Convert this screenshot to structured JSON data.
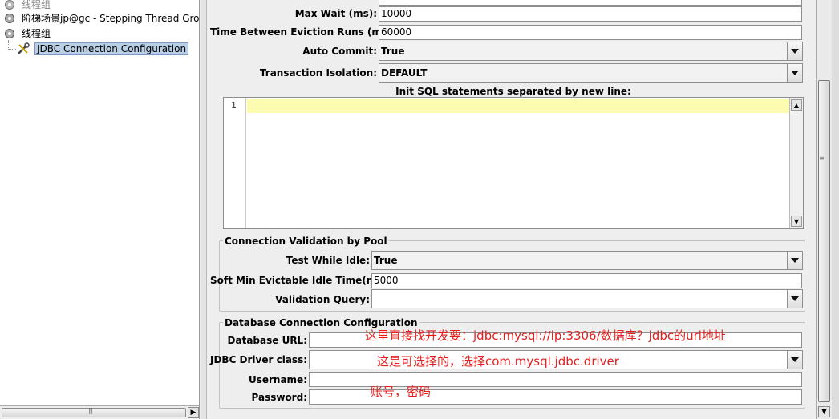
{
  "tree": {
    "items": [
      {
        "label": "线程组",
        "icon": "gear-icon"
      },
      {
        "label": "阶梯场景jp@gc - Stepping Thread Group",
        "icon": "gear-icon"
      },
      {
        "label": "线程组",
        "icon": "gear-icon"
      },
      {
        "label": "JDBC Connection Configuration",
        "icon": "wrench-icon",
        "selected": true
      }
    ]
  },
  "pool": {
    "max_wait_label": "Max Wait (ms):",
    "max_wait_value": "10000",
    "eviction_label": "Time Between Eviction Runs (ms):",
    "eviction_value": "60000",
    "auto_commit_label": "Auto Commit:",
    "auto_commit_value": "True",
    "isolation_label": "Transaction Isolation:",
    "isolation_value": "DEFAULT",
    "init_sql_label": "Init SQL statements separated by new line:",
    "init_sql_line_number": "1"
  },
  "validation": {
    "title": "Connection Validation by Pool",
    "test_idle_label": "Test While Idle:",
    "test_idle_value": "True",
    "soft_min_label": "Soft Min Evictable Idle Time(ms):",
    "soft_min_value": "5000",
    "query_label": "Validation Query:",
    "query_value": ""
  },
  "database": {
    "title": "Database Connection Configuration",
    "url_label": "Database URL:",
    "url_value": "",
    "driver_label": "JDBC Driver class:",
    "driver_value": "",
    "username_label": "Username:",
    "username_value": "",
    "password_label": "Password:",
    "password_value": ""
  },
  "annotations": {
    "url_note": "这里直接找开发要：jdbc:mysql://ip:3306/数据库？jdbc的url地址",
    "driver_note": "这是可选择的，选择com.mysql.jdbc.driver",
    "credentials_note": "账号，密码"
  },
  "colors": {
    "annotation": "#e61e1e",
    "selection": "#b8cfe5",
    "current_line": "#fcfcb0"
  }
}
